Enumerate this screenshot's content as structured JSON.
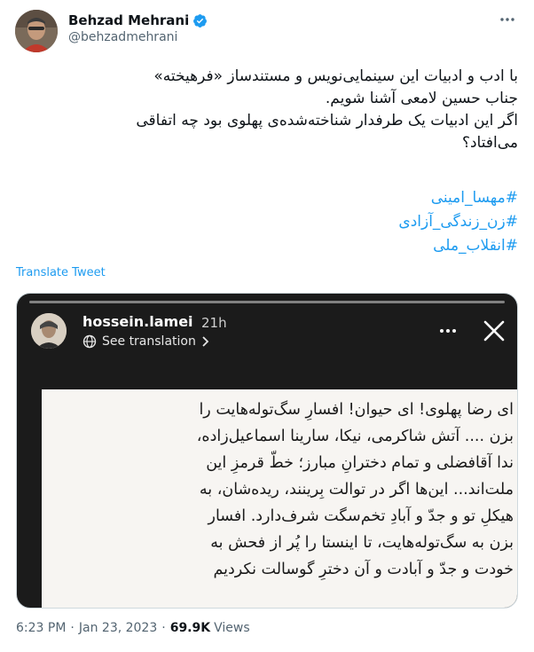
{
  "tweet": {
    "author_name": "Behzad Mehrani",
    "author_handle": "@behzadmehrani",
    "text_lines": [
      "با ادب و ادبیات این سینمایی‌نویس و مستندساز «فرهیخته»",
      "جناب حسین لامعی آشنا شویم.",
      "اگر این ادبیات یک طرفدار شناخته‌شده‌ی پهلوی بود چه اتفاقی",
      "می‌افتاد؟"
    ],
    "hashtags": [
      "#مهسا_امینی",
      "#زن_زندگی_آزادی",
      "#انقلاب_ملی"
    ],
    "translate_label": "Translate Tweet",
    "time": "6:23 PM",
    "date": "Jan 23, 2023",
    "views_count": "69.9K",
    "views_label": "Views",
    "separator": "·",
    "icons": {
      "verified": "verified-badge-icon",
      "more": "more-dots-icon"
    },
    "colors": {
      "accent": "#1d9bf0",
      "secondary_text": "#536471",
      "primary_text": "#0f1419"
    }
  },
  "story": {
    "username": "hossein.lamei",
    "time": "21h",
    "see_translation_label": "See translation",
    "paper_lines": [
      "ای رضا پهلوی! ای حیوان! افسارِ سگ‌توله‌هایت را",
      "بزن .... آتش شاکرمی، نیکا، سارینا اسماعیل‌زاده،",
      "ندا آقافضلی و تمام دخترانِ مبارز؛ خطّ قرمزِ این",
      "ملت‌اند... این‌ها اگر در توالت بِرینند، ریده‌شان، به",
      "هیکلِ تو و جدّ و آبادِ تخم‌سگت شرف‌دارد. افسار",
      "بزن به سگ‌توله‌هایت، تا اینستا را پُر از فحش به",
      "خودت و جدّ و آبادت و آن دخترِ گوسالت نکردیم"
    ],
    "icons": {
      "globe": "globe-icon",
      "chevron": "chevron-right-icon",
      "more": "more-dots-icon",
      "close": "close-icon"
    }
  }
}
